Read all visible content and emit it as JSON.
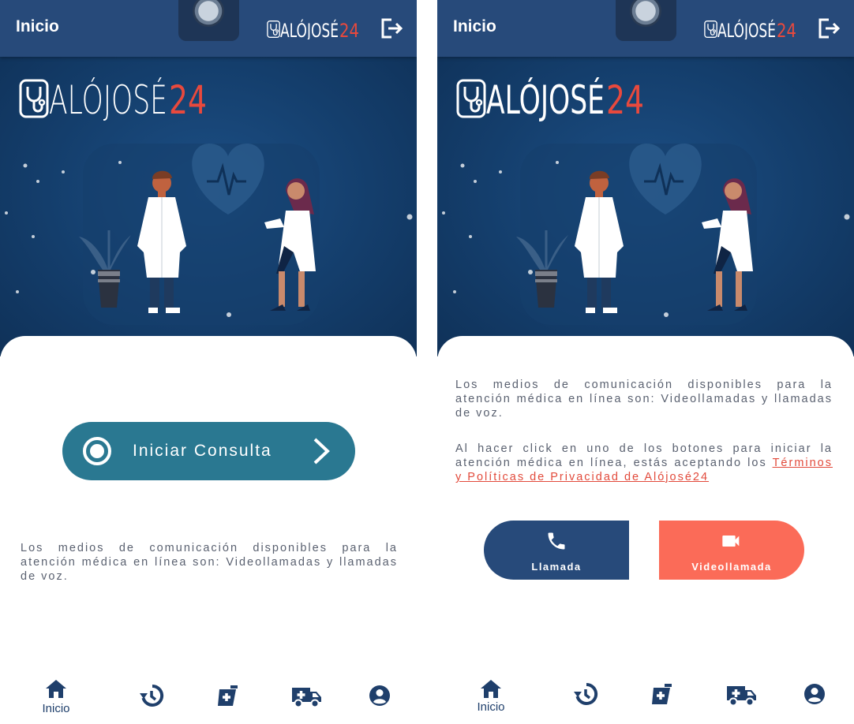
{
  "colors": {
    "navy": "#274a7a",
    "teal_button": "#2a7891",
    "coral_button": "#fb6b58",
    "link_red": "#e24a3b",
    "body_text": "#5a6170"
  },
  "brand": {
    "logo_main": "ALÓJOSÉ",
    "logo_num": "24"
  },
  "left": {
    "topbar": {
      "title": "Inicio"
    },
    "consult_button": {
      "label": "Iniciar Consulta",
      "icon": "radio-icon"
    },
    "info_text": "Los medios de comunicación disponibles para la atención médica en línea son: Videollamadas y llamadas de voz.",
    "nav": [
      {
        "icon": "home-icon",
        "label": "Inicio"
      },
      {
        "icon": "history-icon",
        "label": ""
      },
      {
        "icon": "prescription-icon",
        "label": ""
      },
      {
        "icon": "ambulance-icon",
        "label": ""
      },
      {
        "icon": "account-icon",
        "label": ""
      }
    ]
  },
  "right": {
    "topbar": {
      "title": "Inicio"
    },
    "info_text": "Los medios de comunicación disponibles para la atención médica en línea son: Videollamadas y llamadas de voz.",
    "terms_text": "Al hacer click en uno de los botones para iniciar la atención médica en línea, estás aceptando los ",
    "terms_link": "Términos y Políticas de Privacidad de Alójosé24",
    "call_button": {
      "label": "Llamada",
      "icon": "phone-icon"
    },
    "video_button": {
      "label": "Videollamada",
      "icon": "video-camera-icon"
    },
    "nav": [
      {
        "icon": "home-icon",
        "label": "Inicio"
      },
      {
        "icon": "history-icon",
        "label": ""
      },
      {
        "icon": "prescription-icon",
        "label": ""
      },
      {
        "icon": "ambulance-icon",
        "label": ""
      },
      {
        "icon": "account-icon",
        "label": ""
      }
    ]
  }
}
